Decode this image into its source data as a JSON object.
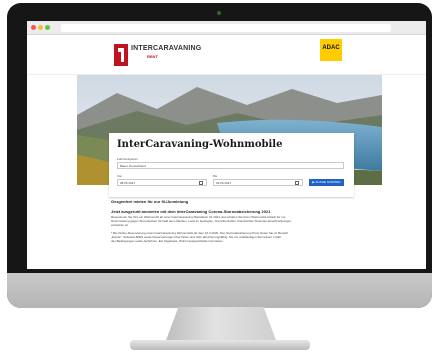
{
  "site": {
    "brand": {
      "name": "INTERCARAVANING",
      "sub": "RENT"
    },
    "partner_logo": "ADAC"
  },
  "search": {
    "title": "InterCaravaning-Wohnmobile",
    "location_label": "Fahrtziel/gebiet",
    "location_value": "Basel, Deutschland",
    "from_label": "Von",
    "from_value": "08.06.2021",
    "to_label": "Bis",
    "to_value": "09.06.2021",
    "button_label": "▶ SUCHE STARTEN"
  },
  "content": {
    "heading_primary": "Gezgenfeel mieten für nur 9L/Anmietung",
    "heading_secondary": "Jetzt ausgeruht anmieten mit dem InterCaravaning Corona-Stornoabsicherung 2021",
    "para_1": [
      "Reservieren Sie Ihre ein Wohnmobil ab einer InterCaravaning Mietstation für 2021 und erhalten Sie Ihren Wohnmobil-Urlaub für nur",
      "9L/Anmietung gegen Stornokosten für bald aus Urlauben. Land im bedingten, Grenzkontrollen Unterkünften-Notierten-Einschränkungen",
      "entstehen ist."
    ],
    "para_2": [
      "* Bei Online-Reservierung eines InterCaravaning Wohnmobils ab dem 10.2.2020. Den Stornoabsicherung Preis finden Sie im Bereich",
      "„Extras\". Teilweise BIEN sowie Reservierungen über Dritte sind nicht absicherungsfähig. Sie zur vollständigen Stornokost. Inhalt",
      "des Bedingungen sowie Gebühren. Ein folgebasis, Wohnt ausgeschließen Anmieten."
    ]
  },
  "colors": {
    "brand_red": "#c1121f",
    "adac_yellow": "#ffcc00",
    "button_blue": "#1f63c6"
  }
}
